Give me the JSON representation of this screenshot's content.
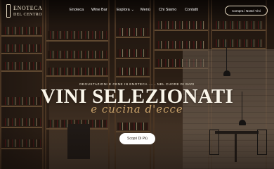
{
  "brand": {
    "line1": "ENOTECA",
    "line2": "DEL CENTRO"
  },
  "nav": {
    "items": [
      {
        "label": "Enoteca"
      },
      {
        "label": "Wine Bar"
      },
      {
        "label": "Esplora"
      },
      {
        "label": "Menù"
      },
      {
        "label": "Chi Siamo"
      },
      {
        "label": "Contatti"
      }
    ],
    "cta_label": "Compra i Nostri Vini"
  },
  "hero": {
    "eyebrow": "DEGUSTAZIONI E CENE IN ENOTECA ...... NEL CUORE DI BARI",
    "title": "VINI SELEZIONATI",
    "script": "e cucina d'ecce",
    "button_label": "Scopri Di Più"
  }
}
